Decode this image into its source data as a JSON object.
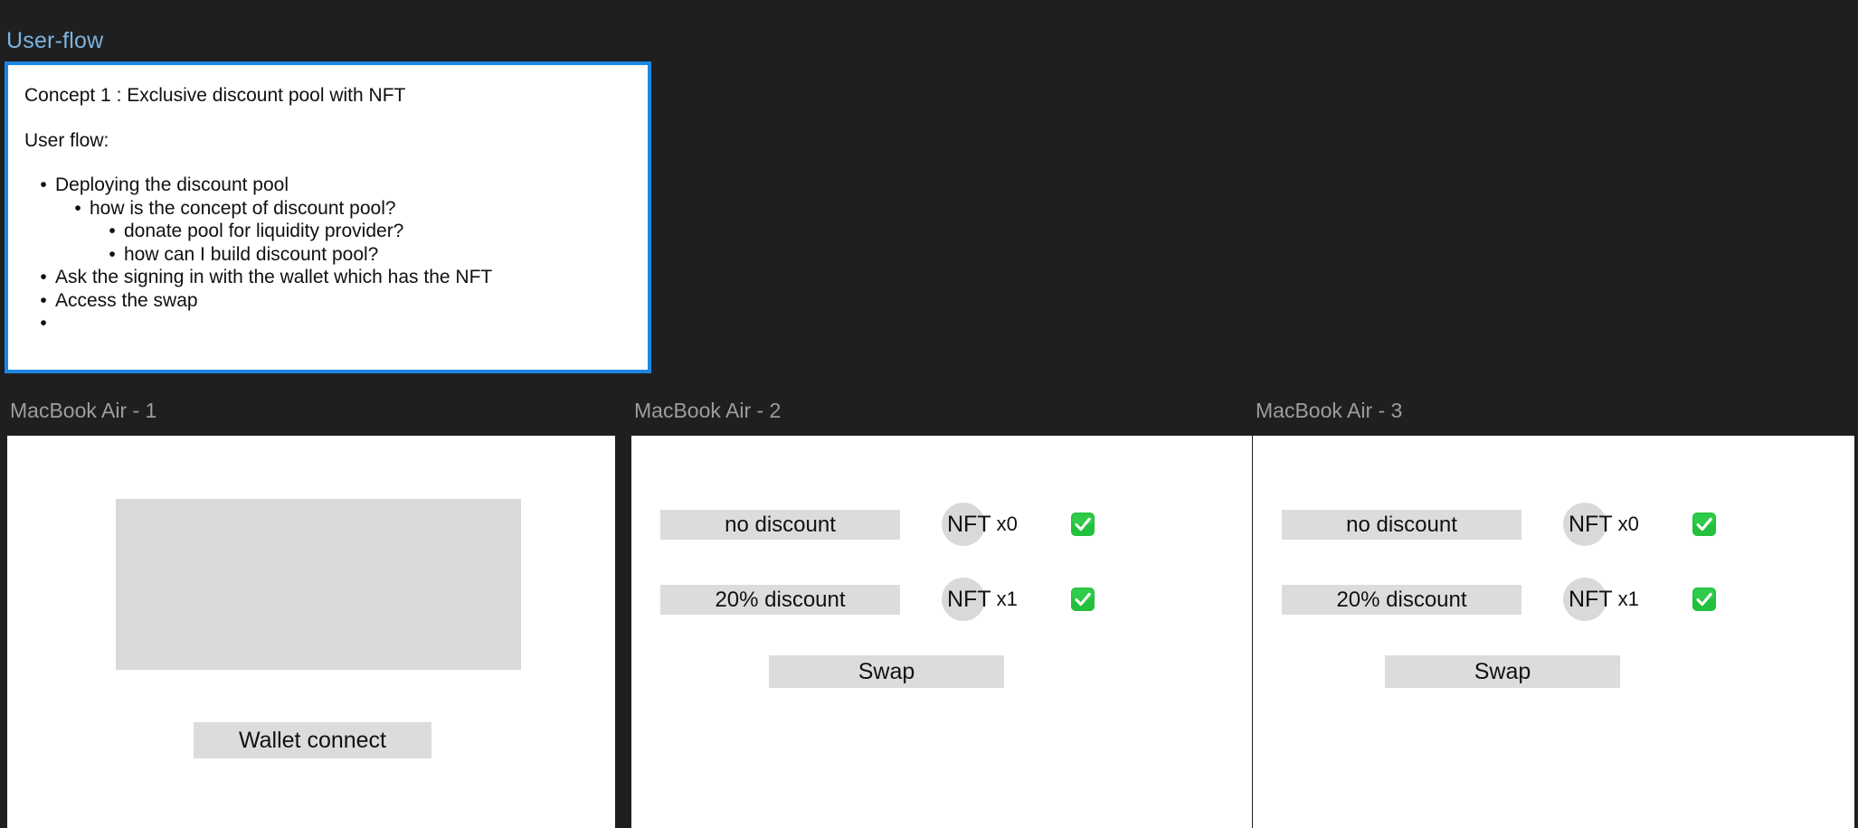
{
  "userflow": {
    "title": "User-flow",
    "concept_line": "Concept 1 :  Exclusive discount pool with NFT",
    "userflow_line": "User flow:",
    "bullets": [
      {
        "text": "Deploying the discount pool",
        "level": 0
      },
      {
        "text": "how is the concept of discount pool?",
        "level": 1
      },
      {
        "text": "donate pool for liquidity provider?",
        "level": 2
      },
      {
        "text": "how can I build discount pool?",
        "level": 2
      },
      {
        "text": "Ask the signing in with the wallet which has the NFT",
        "level": 0
      },
      {
        "text": "Access the swap",
        "level": 0
      },
      {
        "text": "",
        "level": 0
      }
    ]
  },
  "frames": [
    {
      "label": "MacBook Air - 1",
      "kind": "connect",
      "wallet_connect_label": "Wallet connect"
    },
    {
      "label": "MacBook Air - 2",
      "kind": "swap",
      "swap_label": "Swap",
      "rows": [
        {
          "discount": "no discount",
          "nft_label": "NFT",
          "nft_count": "x0",
          "check": "check-mark-button-icon"
        },
        {
          "discount": "20% discount",
          "nft_label": "NFT",
          "nft_count": "x1",
          "check": "check-mark-button-icon"
        }
      ]
    },
    {
      "label": "MacBook Air - 3",
      "kind": "swap",
      "swap_label": "Swap",
      "rows": [
        {
          "discount": "no discount",
          "nft_label": "NFT",
          "nft_count": "x0",
          "check": "check-mark-button-icon"
        },
        {
          "discount": "20% discount",
          "nft_label": "NFT",
          "nft_count": "x1",
          "check": "check-mark-button-icon"
        }
      ]
    }
  ],
  "colors": {
    "canvas_background": "#1f1f1f",
    "card_border": "#1b87e3",
    "title_text": "#7cb3e0",
    "frame_label_text": "#9d9d9d",
    "chip_gray": "#dcdcdc",
    "placeholder_gray": "#d9d9d9",
    "check_green": "#22c03c"
  },
  "bullet_glyph": "•"
}
